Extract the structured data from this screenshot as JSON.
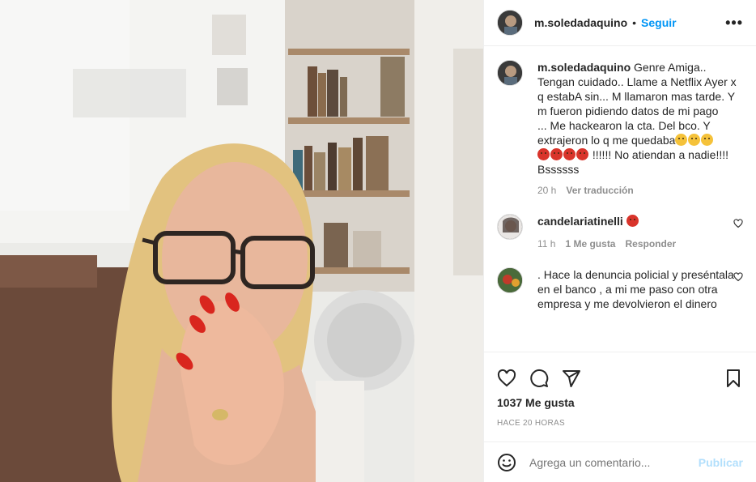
{
  "post": {
    "username": "m.soledadaquino",
    "separator": "•",
    "follow_label": "Seguir",
    "more_label": "•••"
  },
  "caption": {
    "username": "m.soledadaquino",
    "text_1": "Genre Amiga.. Tengan cuidado.. Llame a Netflix Ayer x q estabA sin... M llamaron mas tarde. Y m fueron pidiendo datos de mi pago",
    "text_2": "... Me hackearon la cta. Del bco. Y extrajeron lo q me quedaba",
    "text_3": "!!!!!! No atiendan a nadie!!!! Bssssss",
    "sad_emoji": "sad-face-emoji",
    "angry_emoji": "angry-face-emoji",
    "time": "20 h",
    "translate_label": "Ver traducción"
  },
  "comments": [
    {
      "username": "candelariatinelli",
      "text": "",
      "emoji": "angry-face-emoji",
      "time": "11 h",
      "likes": "1 Me gusta",
      "reply_label": "Responder"
    },
    {
      "username": "",
      "text": ".  Hace la denuncia policial y preséntala en el banco , a mi me paso con otra empresa y me devolvieron el dinero"
    }
  ],
  "actions": {
    "likes_count": "1037 Me gusta",
    "timestamp": "HACE 20 HORAS"
  },
  "add_comment": {
    "placeholder": "Agrega un comentario...",
    "publish_label": "Publicar"
  },
  "colors": {
    "accent": "#0095f6",
    "publish_disabled": "#b2dffc",
    "muted_text": "#8e8e8e",
    "border": "#efefef"
  }
}
